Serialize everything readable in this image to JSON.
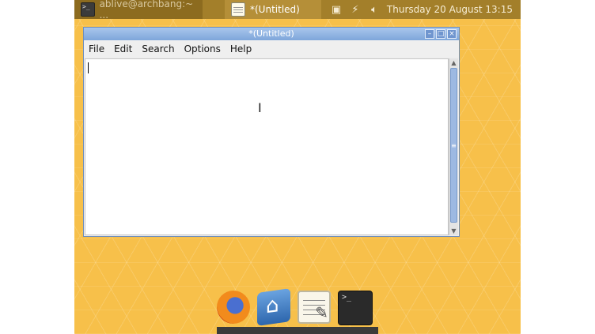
{
  "panel": {
    "tasks": [
      {
        "label": "ablive@archbang:~ ...",
        "icon": "terminal-icon"
      },
      {
        "label": "*(Untitled)",
        "icon": "text-editor-icon"
      }
    ],
    "tray_icons": [
      "display-icon",
      "network-icon",
      "volume-icon"
    ],
    "clock": "Thursday 20 August 13:15",
    "colors": {
      "panel": "#a37f2a",
      "desktop": "#f7c04a"
    }
  },
  "window": {
    "title": "*(Untitled)",
    "controls": [
      "minimize",
      "maximize",
      "close"
    ],
    "menu": [
      "File",
      "Edit",
      "Search",
      "Options",
      "Help"
    ],
    "text": ""
  },
  "dock": {
    "apps": [
      {
        "icon": "firefox-icon"
      },
      {
        "icon": "file-manager-icon"
      },
      {
        "icon": "text-editor-icon"
      },
      {
        "icon": "terminal-icon"
      }
    ]
  }
}
